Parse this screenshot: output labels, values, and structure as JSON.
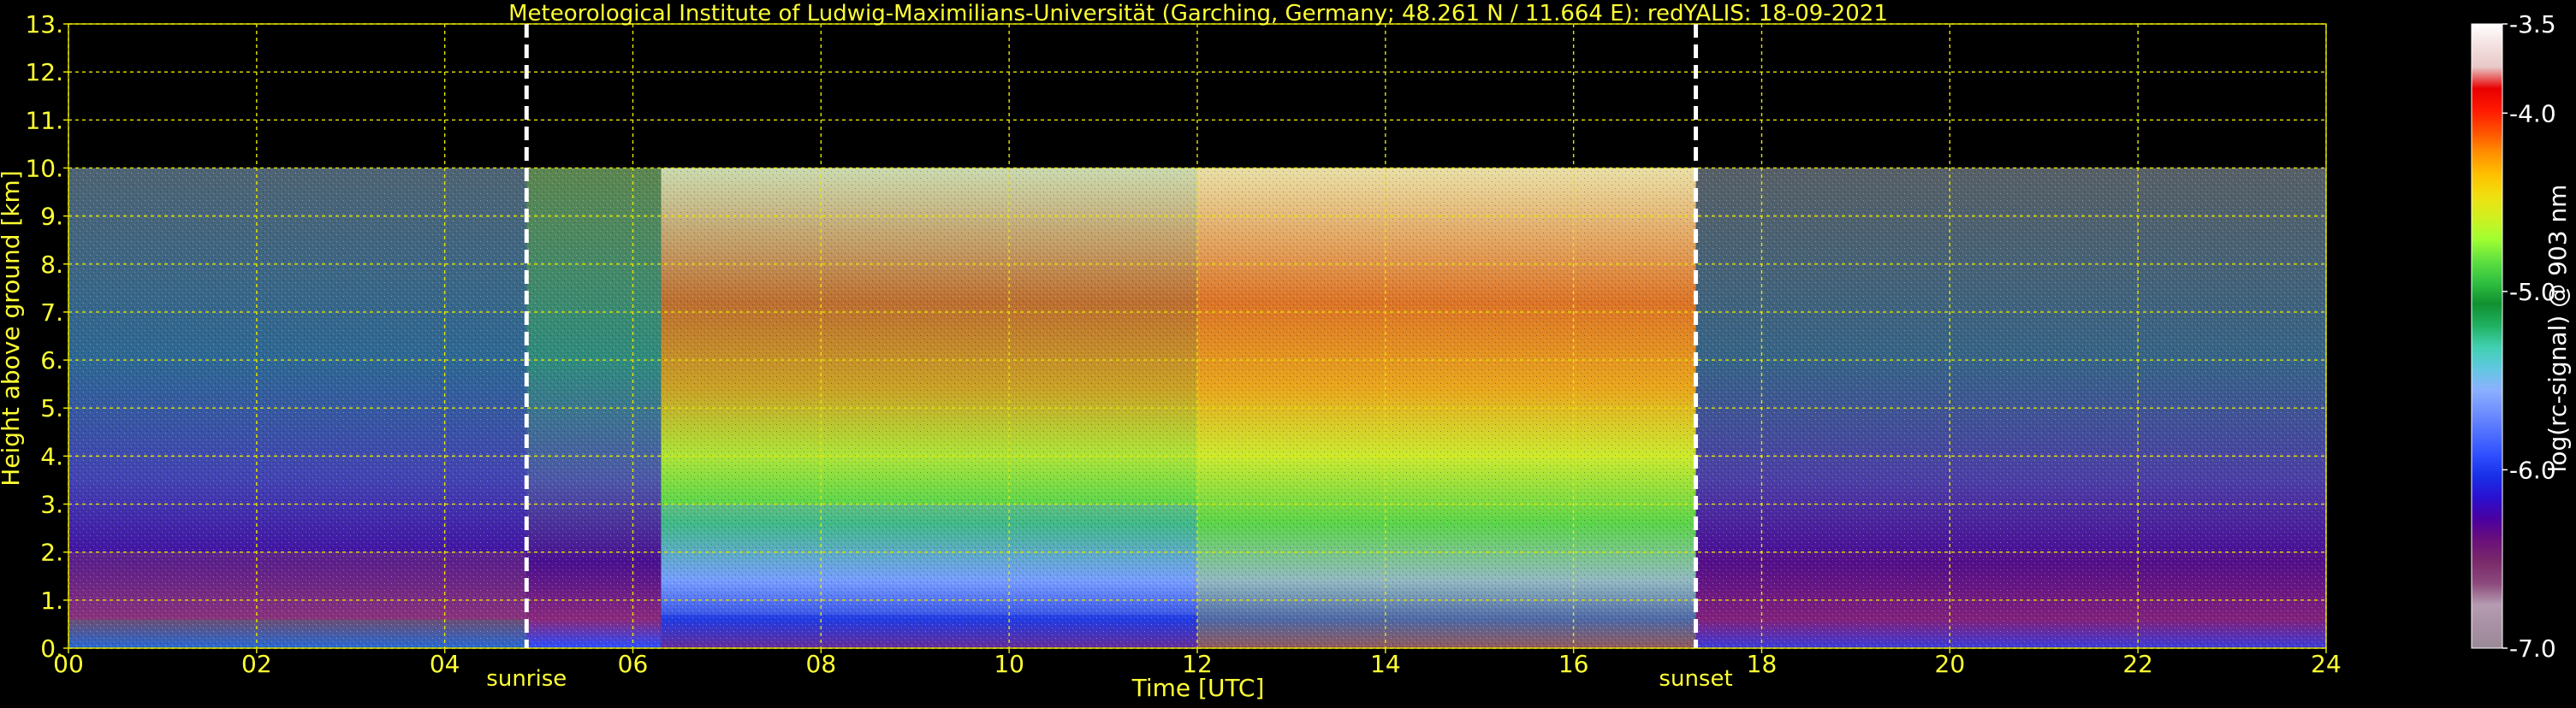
{
  "chart_data": {
    "type": "heatmap",
    "title": "Meteorological Institute of Ludwig-Maximilians-Universität (Garching, Germany; 48.261 N / 11.664 E):    redYALIS: 18-09-2021",
    "xlabel": "Time [UTC]",
    "ylabel": "Height above ground [km]",
    "x_ticks": [
      "00",
      "02",
      "04",
      "06",
      "08",
      "10",
      "12",
      "14",
      "16",
      "18",
      "20",
      "22",
      "24"
    ],
    "x_tick_values": [
      0,
      2,
      4,
      6,
      8,
      10,
      12,
      14,
      16,
      18,
      20,
      22,
      24
    ],
    "y_ticks": [
      "0.",
      "1.",
      "2.",
      "3.",
      "4.",
      "5.",
      "6.",
      "7.",
      "8.",
      "9.",
      "10.",
      "11.",
      "12.",
      "13."
    ],
    "y_tick_values": [
      0,
      1,
      2,
      3,
      4,
      5,
      6,
      7,
      8,
      9,
      10,
      11,
      12,
      13
    ],
    "xlim": [
      0,
      24
    ],
    "ylim": [
      0,
      13
    ],
    "grid": true,
    "data_top_km": 10,
    "markers": [
      {
        "label": "sunrise",
        "time": 4.87
      },
      {
        "label": "sunset",
        "time": 17.3
      }
    ],
    "colorbar": {
      "label": "log(rc-signal) @ 903 nm",
      "ticks": [
        "-3.5",
        "-4.0",
        "-5.0",
        "-6.0",
        "-7.0"
      ],
      "tick_values": [
        -3.5,
        -4.0,
        -5.0,
        -6.0,
        -7.0
      ],
      "range": [
        -7.0,
        -3.5
      ],
      "colors": [
        "#9a8a96",
        "#a890a4",
        "#b59cb0",
        "#8c4a7c",
        "#7a2a6a",
        "#6a107a",
        "#4a00a0",
        "#2a10d0",
        "#1830e8",
        "#3050ff",
        "#5070ff",
        "#7090ff",
        "#8cb0ff",
        "#60c8e0",
        "#40d0b0",
        "#20b060",
        "#109030",
        "#30c040",
        "#60e040",
        "#a0ff30",
        "#d0f020",
        "#f0e010",
        "#ffc000",
        "#ff9000",
        "#ff5000",
        "#ff1800",
        "#e80000",
        "#e8c8c8",
        "#f4e0e0",
        "#ffffff"
      ]
    },
    "colors": {
      "text": "#ffff33",
      "grid": "#e6e600",
      "marker": "#ffffff",
      "colorbar_text": "#ffffff"
    },
    "description_regions": [
      {
        "t0": 0.0,
        "t1": 4.87,
        "h0": 0.0,
        "h1": 0.6,
        "value": -5.2
      },
      {
        "t0": 0.0,
        "t1": 4.87,
        "h0": 0.6,
        "h1": 2.0,
        "value": -6.6
      },
      {
        "t0": 0.0,
        "t1": 4.87,
        "h0": 2.0,
        "h1": 10.0,
        "value": -6.2
      },
      {
        "t0": 6.3,
        "t1": 12.0,
        "h0": 0.0,
        "h1": 0.7,
        "value": -5.9
      },
      {
        "t0": 6.3,
        "t1": 12.0,
        "h0": 0.7,
        "h1": 3.0,
        "value": -5.7
      },
      {
        "t0": 6.3,
        "t1": 12.0,
        "h0": 3.0,
        "h1": 10.0,
        "value": -4.8
      },
      {
        "t0": 12.0,
        "t1": 17.3,
        "h0": 0.0,
        "h1": 10.0,
        "value": -4.6
      },
      {
        "t0": 17.3,
        "t1": 24.0,
        "h0": 0.0,
        "h1": 2.0,
        "value": -6.4
      },
      {
        "t0": 17.3,
        "t1": 24.0,
        "h0": 2.0,
        "h1": 10.0,
        "value": -6.3
      }
    ]
  }
}
